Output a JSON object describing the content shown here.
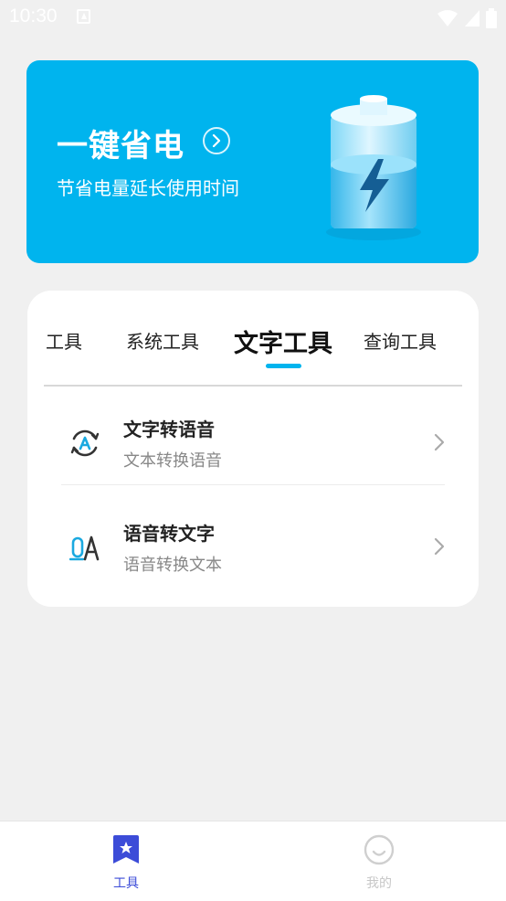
{
  "status_bar": {
    "time": "10:30"
  },
  "banner": {
    "title": "一键省电",
    "subtitle": "节省电量延长使用时间"
  },
  "tabs": [
    {
      "label": "工具",
      "active": false
    },
    {
      "label": "系统工具",
      "active": false
    },
    {
      "label": "文字工具",
      "active": true
    },
    {
      "label": "查询工具",
      "active": false
    }
  ],
  "tools": [
    {
      "title": "文字转语音",
      "subtitle": "文本转换语音",
      "icon": "text-to-speech-icon"
    },
    {
      "title": "语音转文字",
      "subtitle": "语音转换文本",
      "icon": "speech-to-text-icon"
    }
  ],
  "bottom_nav": [
    {
      "label": "工具",
      "icon": "bookmark-star-icon",
      "active": true
    },
    {
      "label": "我的",
      "icon": "smiley-icon",
      "active": false
    }
  ],
  "colors": {
    "accent": "#00b4ee",
    "nav_active": "#3c4cd8",
    "nav_inactive": "#c7c7c7",
    "background": "#f0f0f0"
  }
}
